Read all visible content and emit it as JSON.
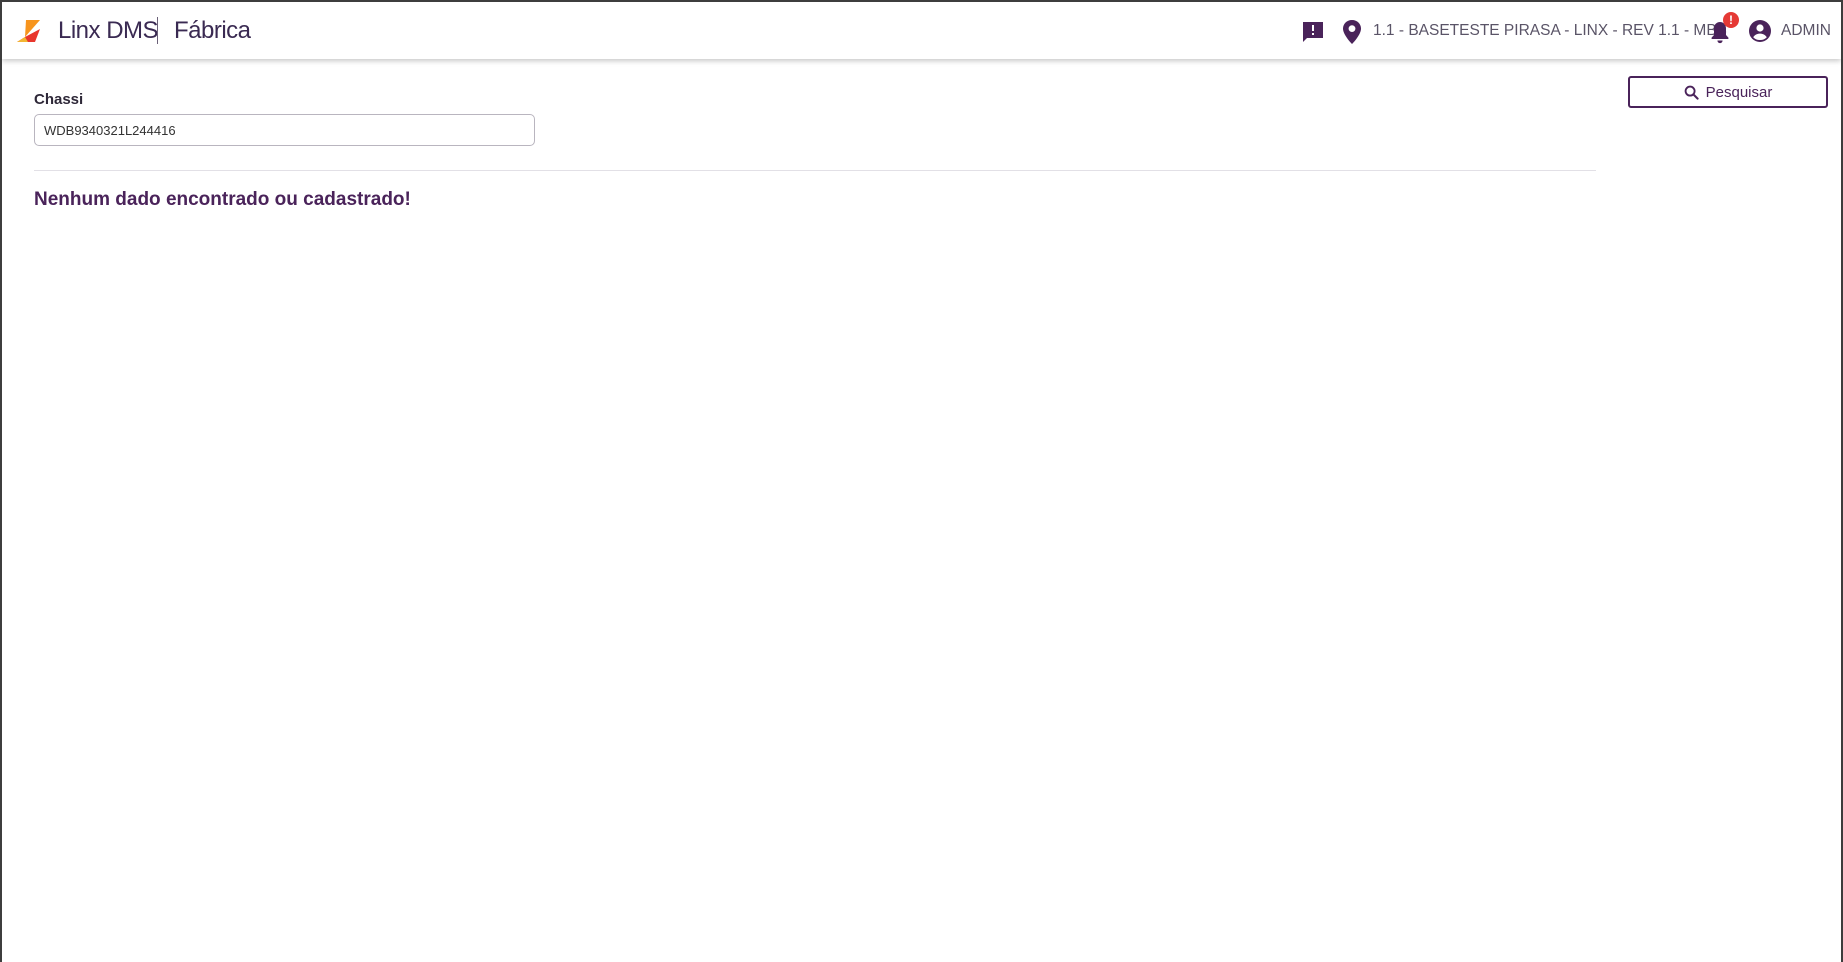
{
  "header": {
    "app_name": "Linx DMS",
    "module_name": "Fábrica",
    "branch": "1.1 - BASETESTE PIRASA - LINX - REV 1.1 - MBB",
    "notification_badge": "!",
    "user": "ADMIN",
    "icons": [
      "linx-logo-icon",
      "chat-alert-icon",
      "location-pin-icon",
      "bell-icon",
      "account-circle-icon"
    ]
  },
  "search": {
    "chassi_label": "Chassi",
    "chassi_value": "WDB9340321L244416",
    "button_label": "Pesquisar",
    "button_icon": "search-icon"
  },
  "results": {
    "empty_message": "Nenhum dado encontrado ou cadastrado!"
  },
  "colors": {
    "brand_purple": "#4a235a",
    "badge_red": "#e53935",
    "logo_orange": "#f7941d",
    "logo_red": "#e8362d"
  }
}
